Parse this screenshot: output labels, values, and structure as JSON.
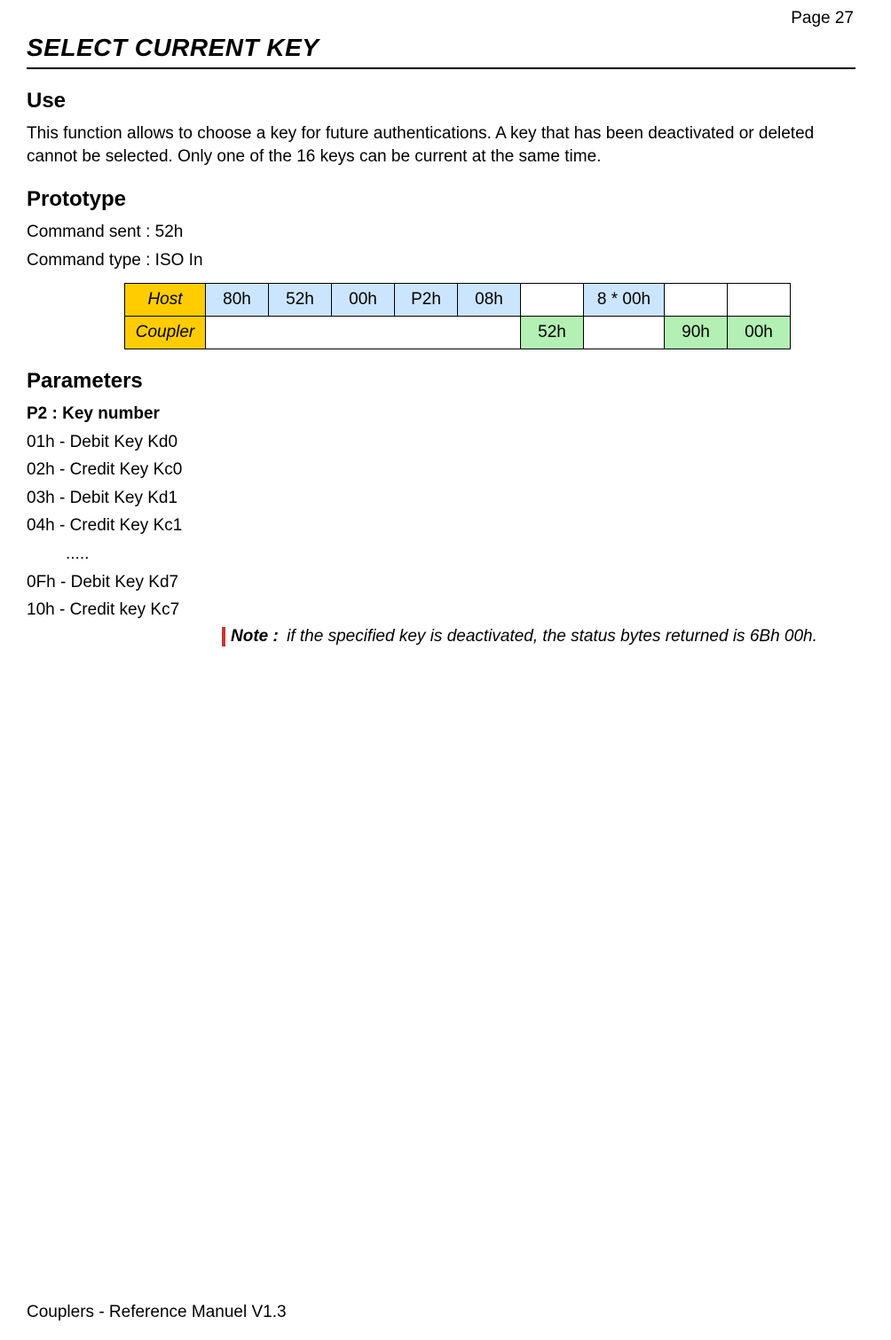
{
  "page_number": "Page 27",
  "title": "SELECT CURRENT KEY",
  "use_heading": "Use",
  "use_text": "This function allows to choose a key for future authentications. A key that has been deactivated or deleted cannot be selected. Only one of the 16 keys can be current at the same time.",
  "proto_heading": "Prototype",
  "proto_lines": {
    "cmd_sent": "Command sent : 52h",
    "cmd_type": "Command type : ISO In"
  },
  "table": {
    "host_label": "Host",
    "coupler_label": "Coupler",
    "host_cells": [
      "80h",
      "52h",
      "00h",
      "P2h",
      "08h",
      "",
      "8 * 00h",
      "",
      ""
    ],
    "coupler_cells": [
      "",
      "",
      "",
      "",
      "",
      "52h",
      "",
      "90h",
      "00h"
    ]
  },
  "params_heading": "Parameters",
  "p2_label": "P2 : Key number",
  "p2_list": [
    "01h - Debit Key Kd0",
    "02h - Credit Key Kc0",
    "03h - Debit Key Kd1",
    "04h - Credit Key Kc1",
    ".....",
    "0Fh - Debit Key Kd7",
    "10h - Credit key Kc7"
  ],
  "note_label": "Note :",
  "note_body": " if the specified key is deactivated, the status bytes returned is 6Bh 00h.",
  "footer": "Couplers - Reference Manuel V1.3"
}
